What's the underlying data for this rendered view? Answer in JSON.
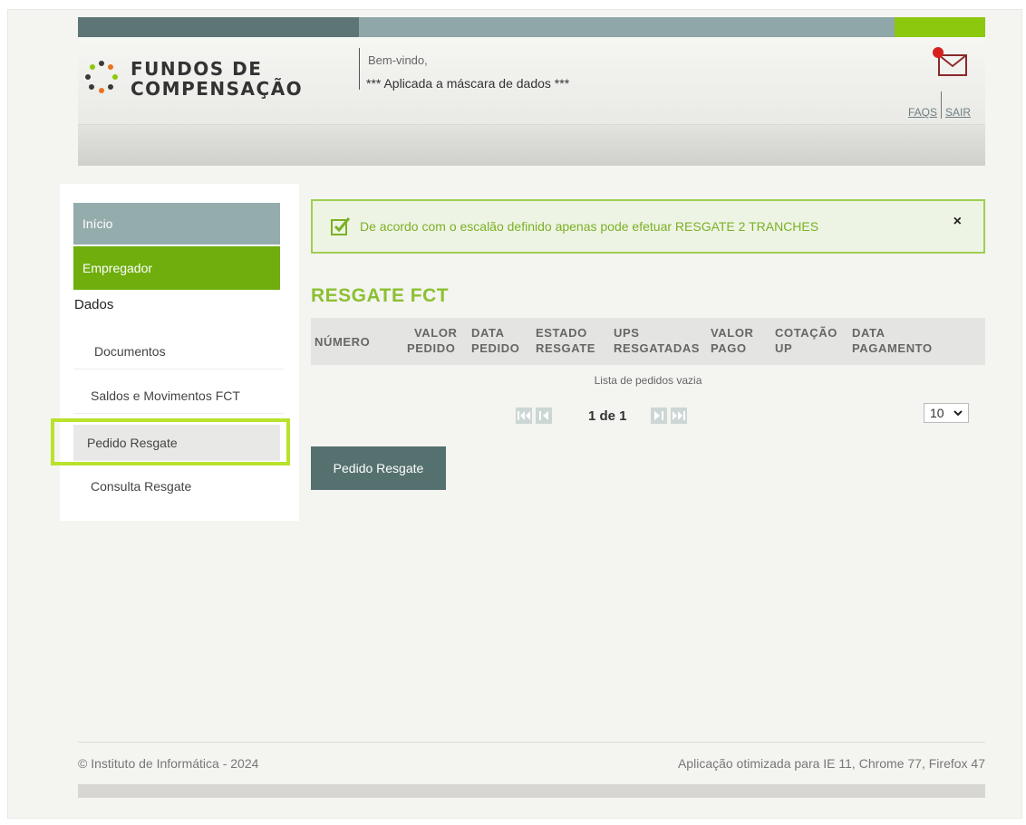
{
  "header": {
    "logo_line1": "FUNDOS DE",
    "logo_line2": "COMPENSAÇÃO",
    "welcome": "Bem-vindo,",
    "mask_note": "*** Aplicada a máscara de dados ***",
    "faqs": "FAQS",
    "sair": "SAIR",
    "mail_icon": "mail-notification-icon"
  },
  "sidebar": {
    "inicio": "Início",
    "empregador": "Empregador",
    "dados": "Dados",
    "documentos": "Documentos",
    "saldos": "Saldos e Movimentos FCT",
    "pedido_resgate": "Pedido Resgate",
    "consulta_resgate": "Consulta Resgate"
  },
  "alert": {
    "text": "De acordo com o escalão definido apenas pode efetuar RESGATE 2 TRANCHES",
    "close": "×"
  },
  "main": {
    "title": "RESGATE FCT",
    "columns": [
      {
        "line1": "NÚMERO",
        "line2": ""
      },
      {
        "line1": "VALOR",
        "line2": "PEDIDO"
      },
      {
        "line1": "DATA",
        "line2": "PEDIDO"
      },
      {
        "line1": "ESTADO",
        "line2": "RESGATE"
      },
      {
        "line1": "UPS",
        "line2": "RESGATADAS"
      },
      {
        "line1": "VALOR",
        "line2": "PAGO"
      },
      {
        "line1": "COTAÇÃO",
        "line2": "UP"
      },
      {
        "line1": "DATA",
        "line2": "PAGAMENTO"
      }
    ],
    "empty_message": "Lista de pedidos vazia",
    "page_info": "1 de 1",
    "page_size": "10",
    "button_label": "Pedido Resgate"
  },
  "footer": {
    "left": "© Instituto de Informática - 2024",
    "right": "Aplicação otimizada para IE 11, Chrome 77, Firefox 47"
  },
  "colors": {
    "accent_green": "#8cc80e",
    "primary_teal": "#55716f",
    "alert_text": "#7bb027"
  }
}
